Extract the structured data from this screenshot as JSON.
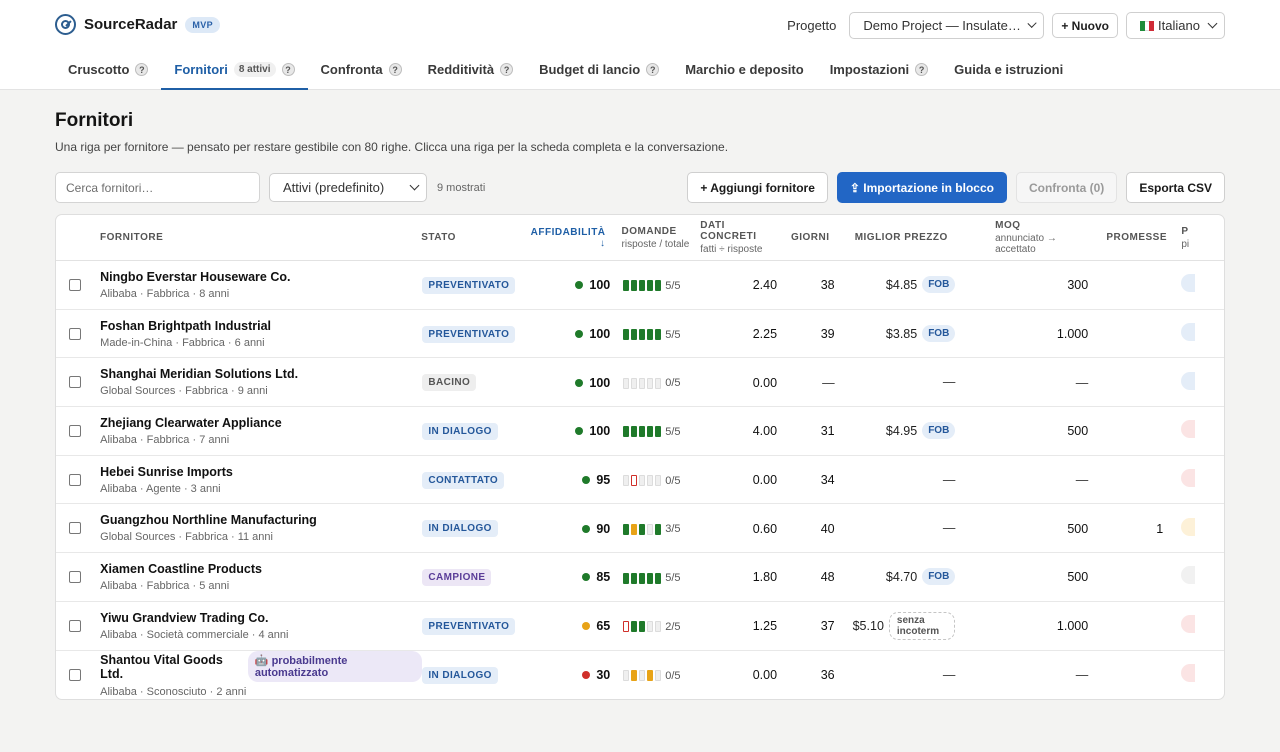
{
  "app": {
    "name": "SourceRadar",
    "badge": "MVP"
  },
  "project": {
    "label": "Progetto",
    "selected": "Demo Project — Insulated S…",
    "new_button": "+ Nuovo"
  },
  "language": {
    "selected": "Italiano"
  },
  "tabs": [
    {
      "label": "Cruscotto",
      "help": "?"
    },
    {
      "label": "Fornitori",
      "count": "8 attivi",
      "help": "?"
    },
    {
      "label": "Confronta",
      "help": "?"
    },
    {
      "label": "Redditività",
      "help": "?"
    },
    {
      "label": "Budget di lancio",
      "help": "?"
    },
    {
      "label": "Marchio e deposito"
    },
    {
      "label": "Impostazioni",
      "help": "?"
    },
    {
      "label": "Guida e istruzioni"
    }
  ],
  "page": {
    "title": "Fornitori",
    "subtitle": "Una riga per fornitore — pensato per restare gestibile con 80 righe. Clicca una riga per la scheda completa e la conversazione."
  },
  "controls": {
    "search_placeholder": "Cerca fornitori…",
    "filter_selected": "Attivi (predefinito)",
    "shown": "9 mostrati",
    "add_button": "+ Aggiungi fornitore",
    "import_button": "⇪ Importazione in blocco",
    "compare_button": "Confronta (0)",
    "export_button": "Esporta CSV"
  },
  "columns": {
    "fornitore": "FORNITORE",
    "stato": "STATO",
    "affidabilita": "AFFIDABILITÀ ↓",
    "domande": "DOMANDE",
    "domande_sub": "risposte / totale",
    "dati": "DATI CONCRETI",
    "dati_sub": "fatti ÷ risposte",
    "giorni": "GIORNI",
    "prezzo": "MIGLIOR PREZZO",
    "moq": "MOQ",
    "moq_sub": "annunciato → accettato",
    "promesse": "PROMESSE",
    "p": "P",
    "p_sub": "pi"
  },
  "colors": {
    "accent": "#1f5fa6",
    "green": "#1f7a2a",
    "yellow": "#e8a317",
    "red": "#d0302a"
  },
  "suppliers": [
    {
      "name": "Ningbo Everstar Houseware Co.",
      "meta": "Alibaba · Fabbrica · 8 anni",
      "status": "PREVENTIVATO",
      "score": "100",
      "score_color": "#1f7a2a",
      "bars": [
        "g",
        "g",
        "g",
        "g",
        "g"
      ],
      "ratio": "5/5",
      "facts": "2.40",
      "days": "38",
      "price": "$4.85",
      "incoterm": "FOB",
      "moq": "300",
      "promises": "",
      "p_color": "#e4edf8"
    },
    {
      "name": "Foshan Brightpath Industrial",
      "meta": "Made-in-China · Fabbrica · 6 anni",
      "status": "PREVENTIVATO",
      "score": "100",
      "score_color": "#1f7a2a",
      "bars": [
        "g",
        "g",
        "g",
        "g",
        "g"
      ],
      "ratio": "5/5",
      "facts": "2.25",
      "days": "39",
      "price": "$3.85",
      "incoterm": "FOB",
      "moq": "1.000",
      "promises": "",
      "p_color": "#e4edf8"
    },
    {
      "name": "Shanghai Meridian Solutions Ltd.",
      "meta": "Global Sources · Fabbrica · 9 anni",
      "status": "BACINO",
      "score": "100",
      "score_color": "#1f7a2a",
      "bars": [
        "e",
        "e",
        "e",
        "e",
        "e"
      ],
      "ratio": "0/5",
      "facts": "0.00",
      "days": "—",
      "price": "—",
      "incoterm": "",
      "moq": "—",
      "promises": "",
      "p_color": "#e4edf8"
    },
    {
      "name": "Zhejiang Clearwater Appliance",
      "meta": "Alibaba · Fabbrica · 7 anni",
      "status": "IN DIALOGO",
      "score": "100",
      "score_color": "#1f7a2a",
      "bars": [
        "g",
        "g",
        "g",
        "g",
        "g"
      ],
      "ratio": "5/5",
      "facts": "4.00",
      "days": "31",
      "price": "$4.95",
      "incoterm": "FOB",
      "moq": "500",
      "promises": "",
      "p_color": "#fbe4e4"
    },
    {
      "name": "Hebei Sunrise Imports",
      "meta": "Alibaba · Agente · 3 anni",
      "status": "CONTATTATO",
      "score": "95",
      "score_color": "#1f7a2a",
      "bars": [
        "e",
        "r",
        "e",
        "e",
        "e"
      ],
      "ratio": "0/5",
      "facts": "0.00",
      "days": "34",
      "price": "—",
      "incoterm": "",
      "moq": "—",
      "promises": "",
      "p_color": "#fbe4e4"
    },
    {
      "name": "Guangzhou Northline Manufacturing",
      "meta": "Global Sources · Fabbrica · 11 anni",
      "status": "IN DIALOGO",
      "score": "90",
      "score_color": "#1f7a2a",
      "bars": [
        "g",
        "y",
        "g",
        "e",
        "g"
      ],
      "ratio": "3/5",
      "facts": "0.60",
      "days": "40",
      "price": "—",
      "incoterm": "",
      "moq": "500",
      "promises": "1",
      "p_color": "#fdf1d8"
    },
    {
      "name": "Xiamen Coastline Products",
      "meta": "Alibaba · Fabbrica · 5 anni",
      "status": "CAMPIONE",
      "score": "85",
      "score_color": "#1f7a2a",
      "bars": [
        "g",
        "g",
        "g",
        "g",
        "g"
      ],
      "ratio": "5/5",
      "facts": "1.80",
      "days": "48",
      "price": "$4.70",
      "incoterm": "FOB",
      "moq": "500",
      "promises": "",
      "p_color": "#f1f1f1"
    },
    {
      "name": "Yiwu Grandview Trading Co.",
      "meta": "Alibaba · Società commerciale · 4 anni",
      "status": "PREVENTIVATO",
      "score": "65",
      "score_color": "#e8a317",
      "bars": [
        "r",
        "g",
        "g",
        "e",
        "e"
      ],
      "ratio": "2/5",
      "facts": "1.25",
      "days": "37",
      "price": "$5.10",
      "incoterm": "senza incoterm",
      "moq": "1.000",
      "promises": "",
      "p_color": "#fbe4e4"
    },
    {
      "name": "Shantou Vital Goods Ltd.",
      "badge": "🤖 probabilmente automatizzato",
      "meta": "Alibaba · Sconosciuto · 2 anni",
      "status": "IN DIALOGO",
      "score": "30",
      "score_color": "#d0302a",
      "bars": [
        "e",
        "y",
        "e",
        "y",
        "e"
      ],
      "ratio": "0/5",
      "facts": "0.00",
      "days": "36",
      "price": "—",
      "incoterm": "",
      "moq": "—",
      "promises": "",
      "p_color": "#fbe4e4"
    }
  ]
}
